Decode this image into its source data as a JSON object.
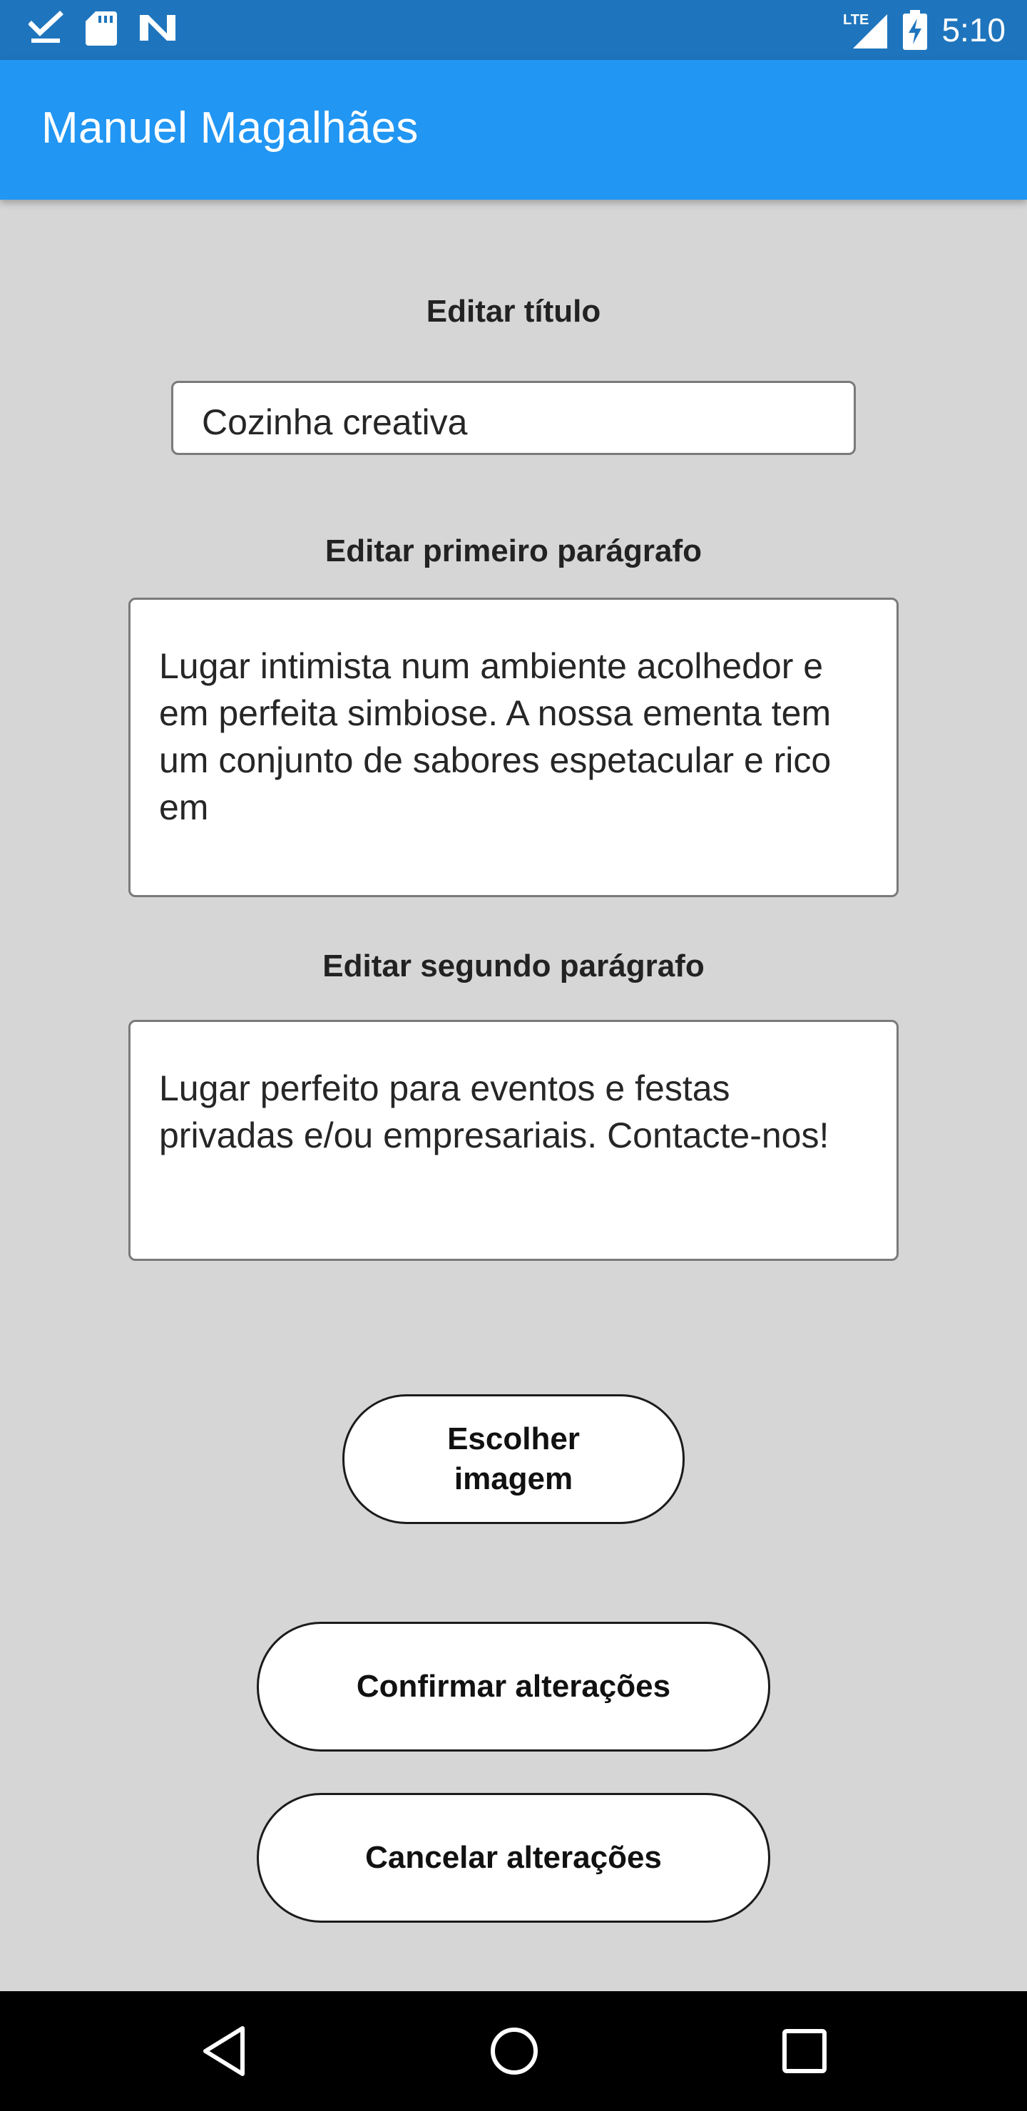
{
  "status_bar": {
    "time": "5:10",
    "network": "LTE",
    "icons_left": [
      "checkbox-icon",
      "sd-card-icon",
      "n-logo-icon"
    ],
    "icons_right": [
      "signal-icon",
      "battery-charging-icon"
    ]
  },
  "app_bar": {
    "title": "Manuel Magalhães",
    "color": "#2196f3"
  },
  "form": {
    "title_label": "Editar título",
    "title_value": "Cozinha creativa",
    "para1_label": "Editar primeiro parágrafo",
    "para1_value": "Lugar intimista num ambiente acolhedor e em perfeita simbiose. A nossa ementa tem um conjunto de sabores espetacular e rico em",
    "para2_label": "Editar segundo parágrafo",
    "para2_value": "Lugar perfeito para eventos e festas privadas e/ou empresariais. Contacte-nos!"
  },
  "buttons": {
    "choose_image": "Escolher imagem",
    "confirm": "Confirmar alterações",
    "cancel": "Cancelar alterações"
  },
  "nav_bar": {
    "items": [
      "back-icon",
      "home-icon",
      "recents-icon"
    ]
  }
}
